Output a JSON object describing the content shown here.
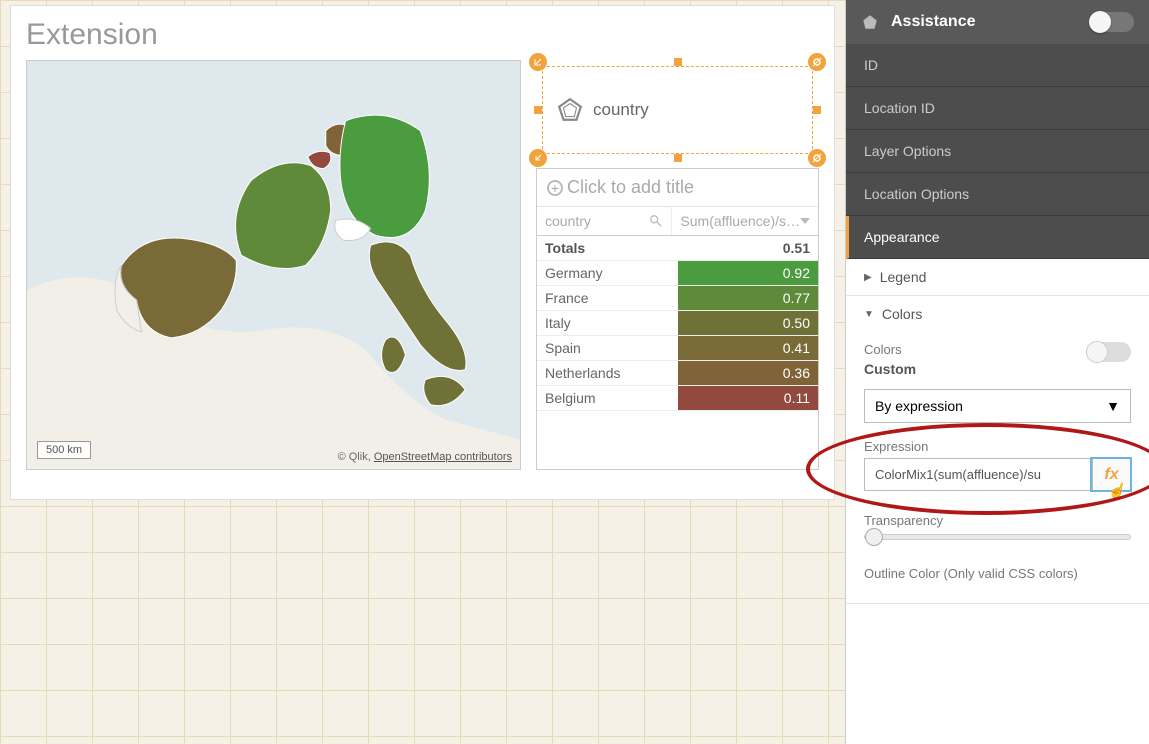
{
  "main": {
    "title": "Extension",
    "map": {
      "scale_label": "500 km",
      "attribution_prefix": "© Qlik, ",
      "attribution_link": "OpenStreetMap contributors"
    },
    "legend": {
      "label": "country"
    },
    "table": {
      "title_placeholder": "Click to add title",
      "col1": "country",
      "col2": "Sum(affluence)/s…",
      "totals_label": "Totals",
      "totals_value": "0.51",
      "rows": [
        {
          "name": "Germany",
          "value": "0.92",
          "color": "#4b9b3f"
        },
        {
          "name": "France",
          "value": "0.77",
          "color": "#5f8a3a"
        },
        {
          "name": "Italy",
          "value": "0.50",
          "color": "#6f7136"
        },
        {
          "name": "Spain",
          "value": "0.41",
          "color": "#7a6a37"
        },
        {
          "name": "Netherlands",
          "value": "0.36",
          "color": "#806338"
        },
        {
          "name": "Belgium",
          "value": "0.11",
          "color": "#924a3e"
        }
      ]
    }
  },
  "panel": {
    "header": "Assistance",
    "nav": {
      "id": "ID",
      "location_id": "Location ID",
      "layer_options": "Layer Options",
      "location_options": "Location Options",
      "appearance": "Appearance"
    },
    "legend_section": "Legend",
    "colors_section": "Colors",
    "colors": {
      "label": "Colors",
      "mode": "Custom",
      "dropdown": "By expression",
      "expression_label": "Expression",
      "expression_value": "ColorMix1(sum(affluence)/su",
      "fx": "fx",
      "transparency_label": "Transparency",
      "outline_label": "Outline Color (Only valid CSS colors)"
    }
  }
}
